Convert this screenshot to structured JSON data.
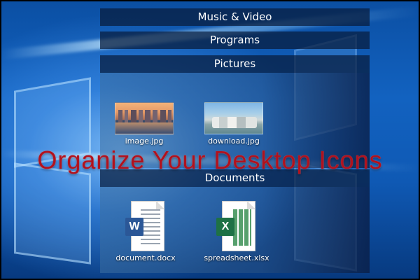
{
  "overlay_title": "Organize Your Desktop Icons",
  "fences": {
    "music": {
      "title": "Music & Video"
    },
    "programs": {
      "title": "Programs"
    },
    "pictures": {
      "title": "Pictures",
      "items": [
        {
          "label": "image.jpg",
          "icon": "image-thumbnail-city"
        },
        {
          "label": "download.jpg",
          "icon": "image-thumbnail-bay"
        }
      ]
    },
    "documents": {
      "title": "Documents",
      "items": [
        {
          "label": "document.docx",
          "icon": "word-document-icon",
          "badge": "W"
        },
        {
          "label": "spreadsheet.xlsx",
          "icon": "excel-spreadsheet-icon",
          "badge": "X"
        }
      ]
    }
  },
  "colors": {
    "wallpaper": "#0b4fa3",
    "fence_header": "#081c3c",
    "overlay_title": "#b0121e",
    "word_badge": "#2b5797",
    "excel_badge": "#1e7145"
  }
}
